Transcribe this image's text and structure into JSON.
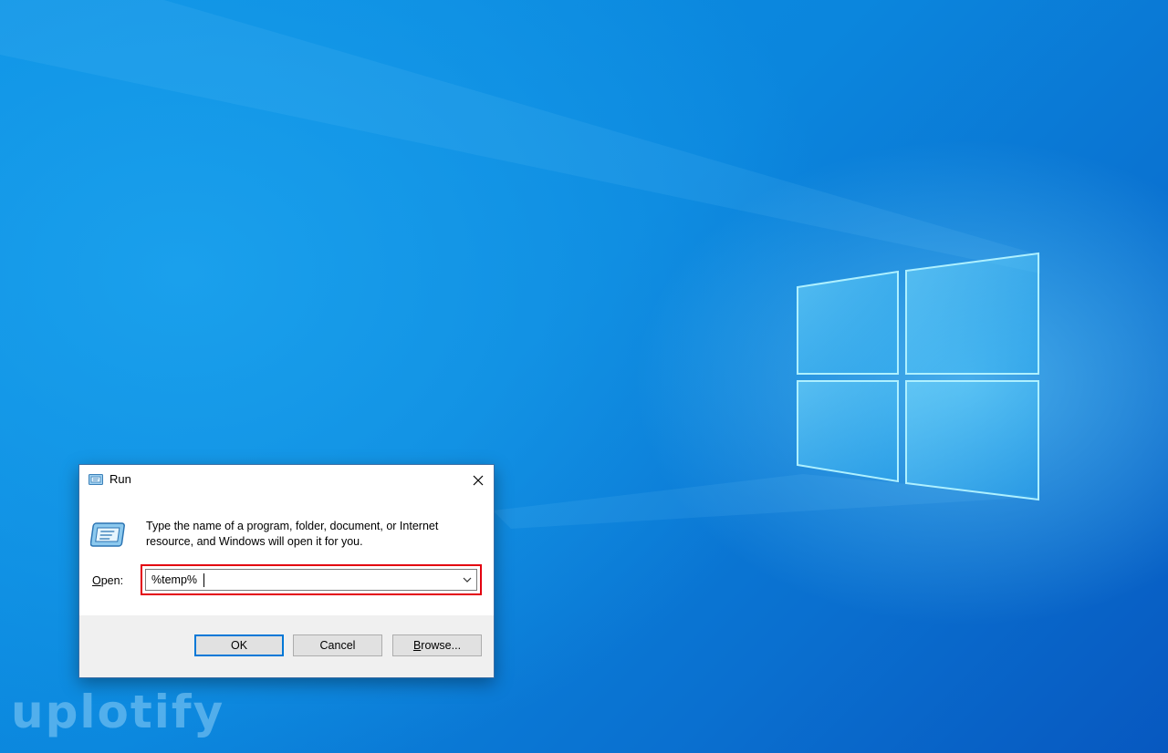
{
  "desktop": {
    "background_colors": [
      "#0a8fe3",
      "#0758c0"
    ],
    "logo_icon": "windows-logo-icon"
  },
  "run_dialog": {
    "title": "Run",
    "title_icon": "run-icon",
    "close_icon": "close-icon",
    "description": "Type the name of a program, folder, document, or Internet resource, and Windows will open it for you.",
    "open_label_prefix": "O",
    "open_label_rest": "pen:",
    "open_value": "%temp%",
    "dropdown_icon": "chevron-down-icon",
    "highlight_color": "#e3000f",
    "buttons": {
      "ok": "OK",
      "cancel": "Cancel",
      "browse_prefix": "B",
      "browse_rest": "rowse..."
    }
  },
  "watermark": {
    "text": "uplotify"
  }
}
